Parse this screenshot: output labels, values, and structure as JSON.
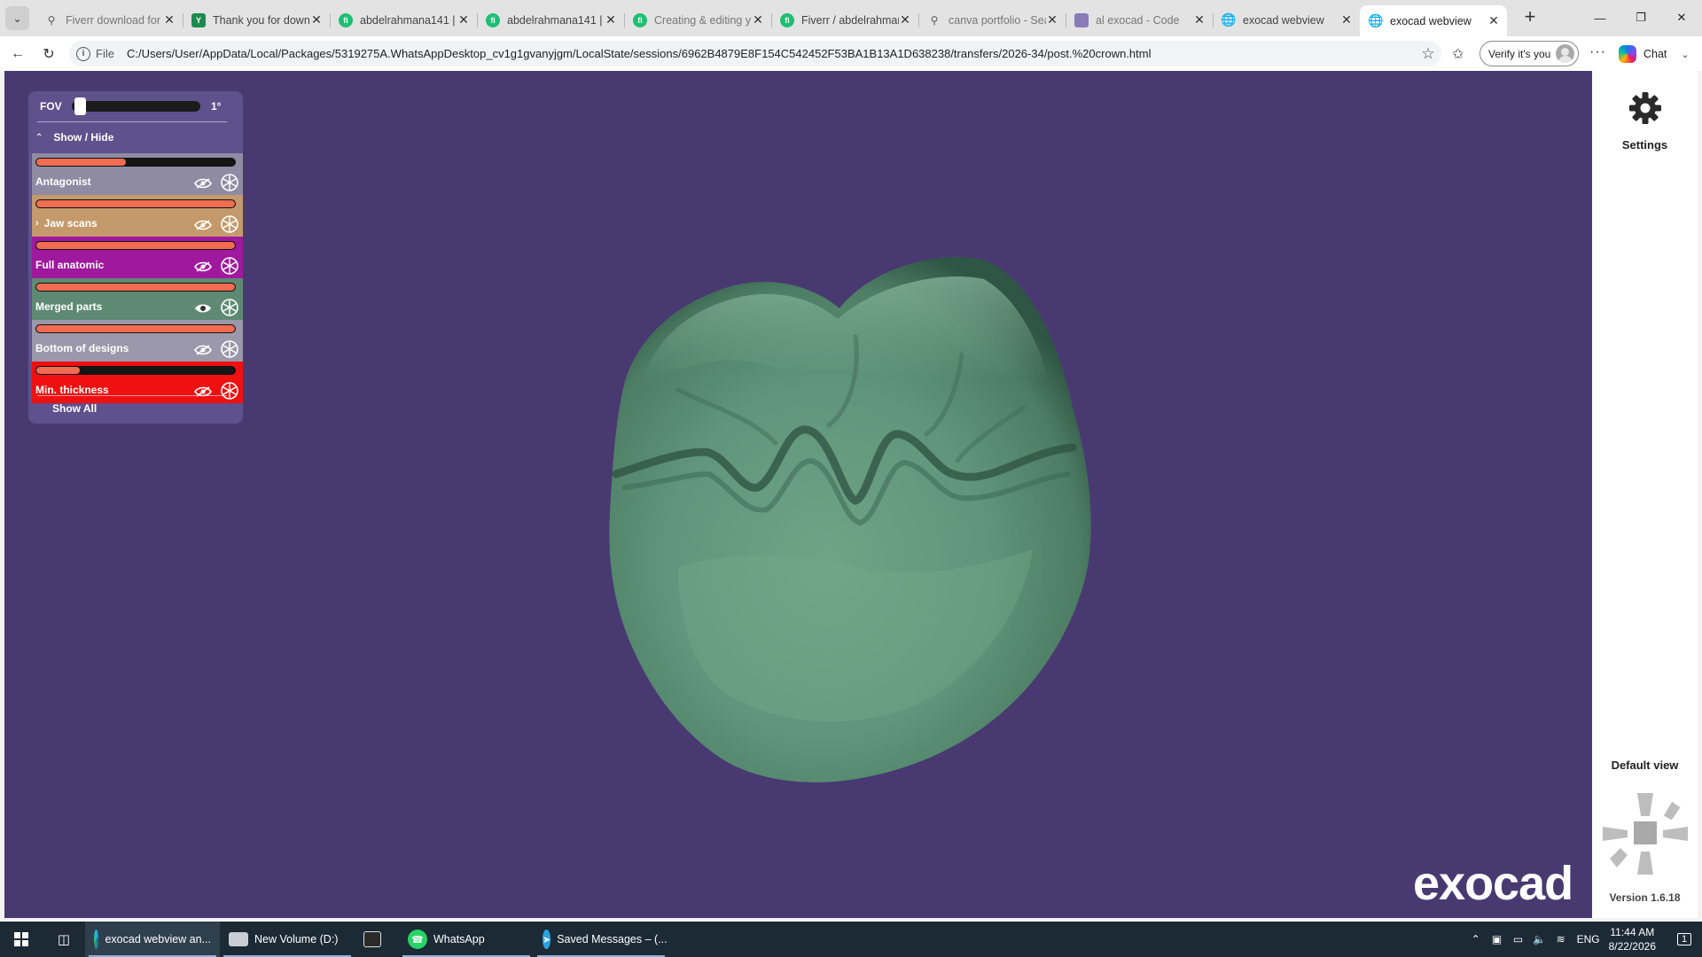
{
  "browser": {
    "tabs": [
      {
        "label": "Fiverr download for",
        "icon": "search-icon",
        "faded": true
      },
      {
        "label": "Thank you for downl",
        "icon": "y-site-icon",
        "faded": false
      },
      {
        "label": "abdelrahmana141 | F",
        "icon": "fiverr-icon",
        "faded": false
      },
      {
        "label": "abdelrahmana141 | F",
        "icon": "fiverr-icon",
        "faded": false
      },
      {
        "label": "Creating & editing y",
        "icon": "fiverr-icon",
        "faded": true
      },
      {
        "label": "Fiverr / abdelrahman",
        "icon": "fiverr-icon",
        "faded": false
      },
      {
        "label": "canva portfolio - Sea",
        "icon": "search-icon",
        "faded": true
      },
      {
        "label": "al exocad - Code",
        "icon": "app-icon",
        "faded": true
      },
      {
        "label": "exocad webview",
        "icon": "globe-icon",
        "faded": false
      },
      {
        "label": "exocad webview",
        "icon": "globe-icon",
        "faded": false,
        "active": true
      }
    ],
    "url_scheme": "File",
    "url": "C:/Users/User/AppData/Local/Packages/5319275A.WhatsAppDesktop_cv1g1gvanyjgm/LocalState/sessions/6962B4879E8F154C542452F53BA1B13A1D638238/transfers/2026-34/post.%20crown.html",
    "verify_label": "Verify it's you",
    "chat_label": "Chat"
  },
  "viewer": {
    "fov": {
      "label": "FOV",
      "value_text": "1°",
      "value_fraction": 0.02
    },
    "showhide_label": "Show / Hide",
    "layers": [
      {
        "name": "Antagonist",
        "color": "#8e8ba3",
        "opacity": 0.45,
        "visible": false,
        "expandable": false
      },
      {
        "name": "Jaw scans",
        "color": "#c49a6c",
        "opacity": 1.0,
        "visible": false,
        "expandable": true
      },
      {
        "name": "Full anatomic",
        "color": "#a0189e",
        "opacity": 1.0,
        "visible": false,
        "expandable": false
      },
      {
        "name": "Merged parts",
        "color": "#5e8a73",
        "opacity": 1.0,
        "visible": true,
        "expandable": false
      },
      {
        "name": "Bottom of designs",
        "color": "#9b98ab",
        "opacity": 1.0,
        "visible": false,
        "expandable": false
      },
      {
        "name": "Min. thickness",
        "color": "#f01010",
        "opacity": 0.22,
        "visible": false,
        "expandable": false
      }
    ],
    "show_all_label": "Show All",
    "settings_label": "Settings",
    "default_view_label": "Default view",
    "version_label": "Version 1.6.18",
    "logo_text": "exocad",
    "colors": {
      "background": "#483a71",
      "crown": "#5b8f74",
      "accent": "#f26c52"
    }
  },
  "taskbar": {
    "items": [
      {
        "label": "exocad webview an...",
        "icon": "edge-icon",
        "running": true,
        "active": true
      },
      {
        "label": "New Volume (D:)",
        "icon": "drive-icon",
        "running": true,
        "active": false
      },
      {
        "label": "",
        "icon": "clapper-icon",
        "running": false,
        "active": false
      },
      {
        "label": "WhatsApp",
        "icon": "whatsapp-icon",
        "running": true,
        "active": false
      },
      {
        "label": "Saved Messages – (...",
        "icon": "telegram-icon",
        "running": true,
        "active": false
      }
    ],
    "language": "ENG",
    "time": "11:44 AM",
    "date": "8/22/2026",
    "notification_count": "1"
  }
}
